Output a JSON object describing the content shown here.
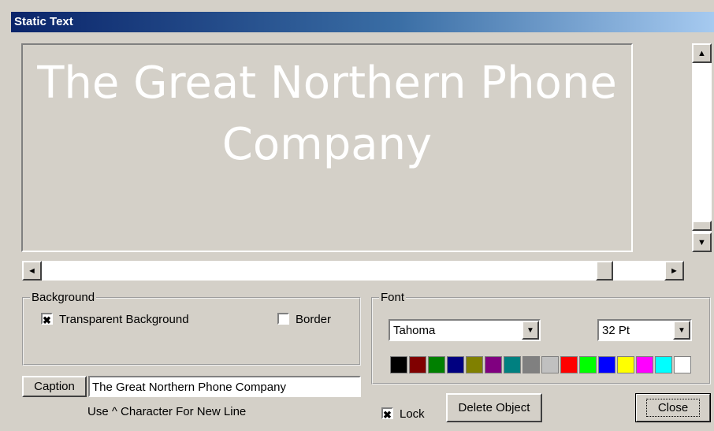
{
  "window": {
    "title": "Static Text"
  },
  "preview": {
    "text": "The Great Northern Phone Company",
    "scroll_left": "◄",
    "scroll_right": "►",
    "scroll_up": "▲",
    "scroll_down": "▼"
  },
  "background_group": {
    "legend": "Background",
    "transparent": {
      "label": "Transparent Background",
      "checked": true,
      "mark": "✖"
    },
    "border": {
      "label": "Border",
      "checked": false,
      "mark": ""
    }
  },
  "font_group": {
    "legend": "Font",
    "font_name": "Tahoma",
    "font_size": "32 Pt",
    "dropdown_arrow": "▼",
    "palette": [
      "#000000",
      "#800000",
      "#008000",
      "#000080",
      "#808000",
      "#800080",
      "#008080",
      "#808080",
      "#c0c0c0",
      "#ff0000",
      "#00ff00",
      "#0000ff",
      "#ffff00",
      "#ff00ff",
      "#00ffff",
      "#ffffff"
    ]
  },
  "caption": {
    "label": "Caption",
    "value": "The Great Northern Phone Company",
    "hint": "Use ^ Character For New Line"
  },
  "lock": {
    "label": "Lock",
    "checked": true,
    "mark": "✖"
  },
  "buttons": {
    "delete": "Delete Object",
    "close": "Close"
  }
}
